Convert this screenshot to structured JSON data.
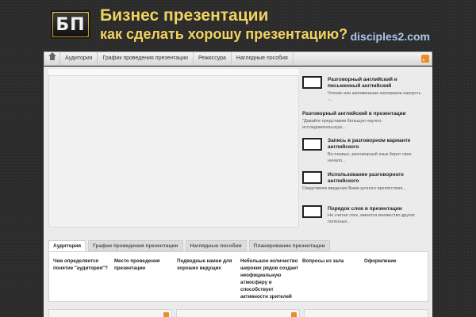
{
  "header": {
    "logo_text": "БП",
    "title": "Бизнес презентации",
    "tagline": "как сделать хорошу презентацию?",
    "domain": "disciples2.com"
  },
  "nav": {
    "items": [
      "Аудитория",
      "График проведения презентации",
      "Режиссура",
      "Наглядные пособия"
    ]
  },
  "sidebar": {
    "posts": [
      {
        "title": "Разговорный английский и письменный английский",
        "excerpt": "Чтение или запоминание материала наизусть -..."
      },
      {
        "title": "Разговорный английский в презентации",
        "excerpt": "\"Давайте представим большую научно-исследовательскую..."
      },
      {
        "title": "Запись в разговорном варианте английского",
        "excerpt": "Во-первых, разговорный язык берет свое начало..."
      },
      {
        "title": "Использование разговорного английского",
        "excerpt": "Сведствием введения Вами ручного препятствия..."
      },
      {
        "title": "Порядок слов в презентации",
        "excerpt": "Не считая этих, имеется множество других полезных..."
      }
    ]
  },
  "tabs": {
    "labels": [
      "Аудитория",
      "График проведения презентации",
      "Наглядные пособия",
      "Планирование презентации"
    ],
    "links": [
      "Чем определяется понятие \"аудитория\"?",
      "Место проведения презентации",
      "Подводные камни для хороших ведущих",
      "Небольшое количество широких рядов создает неофициальную атмосферу и способствует активности зрителей",
      "Вопросы из зала",
      "Оформление"
    ]
  }
}
